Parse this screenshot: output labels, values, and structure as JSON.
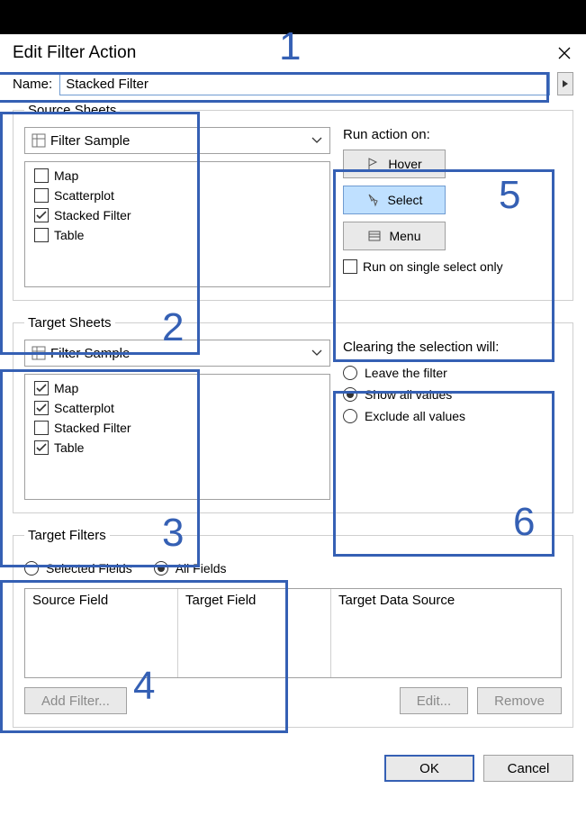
{
  "title": "Edit Filter Action",
  "name_label": "Name:",
  "name_value": "Stacked Filter",
  "source": {
    "legend": "Source Sheets",
    "workbook": "Filter Sample",
    "items": [
      {
        "label": "Map",
        "checked": false
      },
      {
        "label": "Scatterplot",
        "checked": false
      },
      {
        "label": "Stacked Filter",
        "checked": true
      },
      {
        "label": "Table",
        "checked": false
      }
    ]
  },
  "run_action": {
    "title": "Run action on:",
    "buttons": [
      {
        "label": "Hover",
        "selected": false
      },
      {
        "label": "Select",
        "selected": true
      },
      {
        "label": "Menu",
        "selected": false
      }
    ],
    "single_select_label": "Run on single select only",
    "single_select_checked": false
  },
  "target": {
    "legend": "Target Sheets",
    "workbook": "Filter Sample",
    "items": [
      {
        "label": "Map",
        "checked": true
      },
      {
        "label": "Scatterplot",
        "checked": true
      },
      {
        "label": "Stacked Filter",
        "checked": false
      },
      {
        "label": "Table",
        "checked": true
      }
    ]
  },
  "clearing": {
    "title": "Clearing the selection will:",
    "options": [
      {
        "label": "Leave the filter",
        "selected": false
      },
      {
        "label": "Show all values",
        "selected": true
      },
      {
        "label": "Exclude all values",
        "selected": false
      }
    ]
  },
  "target_filters": {
    "legend": "Target Filters",
    "scope": [
      {
        "label": "Selected Fields",
        "selected": false
      },
      {
        "label": "All Fields",
        "selected": true
      }
    ],
    "columns": [
      "Source Field",
      "Target Field",
      "Target Data Source"
    ],
    "add_label": "Add Filter...",
    "edit_label": "Edit...",
    "remove_label": "Remove"
  },
  "footer": {
    "ok": "OK",
    "cancel": "Cancel"
  },
  "annotations": {
    "n1": "1",
    "n2": "2",
    "n3": "3",
    "n4": "4",
    "n5": "5",
    "n6": "6"
  }
}
